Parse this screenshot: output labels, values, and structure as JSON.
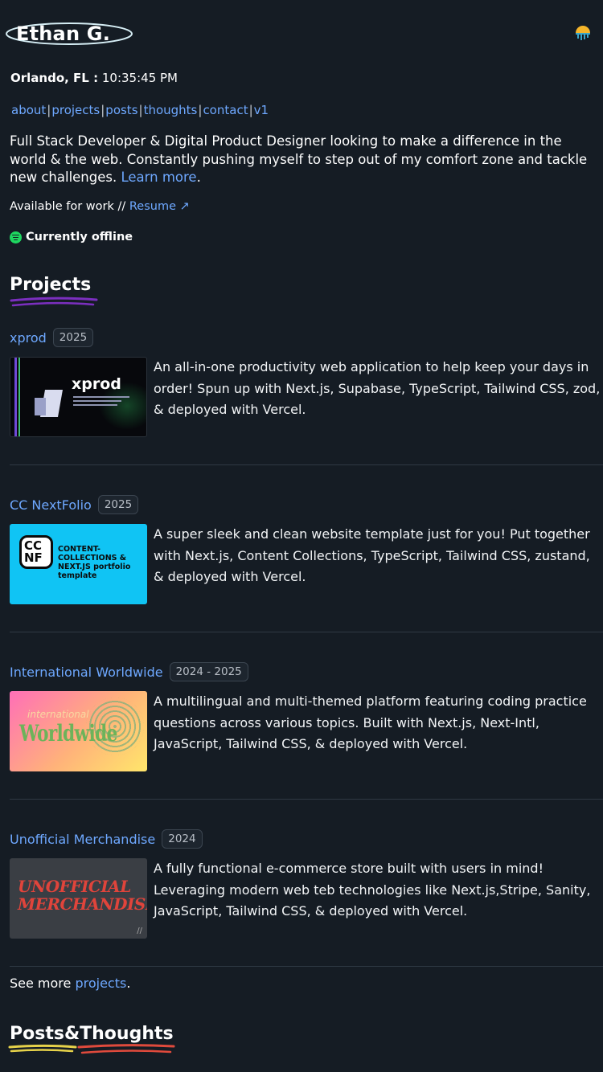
{
  "header": {
    "name": "Ethan G.",
    "location_city": "Orlando, FL :",
    "time": "10:35:45 PM"
  },
  "nav": {
    "items": [
      "about",
      "projects",
      "posts",
      "thoughts",
      "contact",
      "v1"
    ]
  },
  "bio": {
    "text": "Full Stack Developer & Digital Product Designer looking to make a difference in the world & the web. Constantly pushing myself to step out of my comfort zone and tackle new challenges. ",
    "link": "Learn more",
    "end": "."
  },
  "availability": {
    "text": "Available for work //",
    "resume": "Resume ↗"
  },
  "status": {
    "icon": "spotify-icon",
    "text": "Currently offline",
    "color": "#1ed760"
  },
  "projects_section": {
    "heading": "Projects",
    "accent": "#7b2fbf",
    "items": [
      {
        "title": "xprod",
        "year": "2025",
        "thumb_text": "xprod",
        "description": "An all-in-one productivity web application to help keep your days in order! Spun up with Next.js, Supabase, TypeScript, Tailwind CSS, zod, & deployed with Vercel."
      },
      {
        "title": "CC NextFolio",
        "year": "2025",
        "thumb_text": "CONTENT-COLLECTIONS & NEXT.JS portfolio template",
        "description": "A super sleek and clean website template just for you! Put together with Next.js, Content Collections, TypeScript, Tailwind CSS, zustand, & deployed with Vercel."
      },
      {
        "title": "International Worldwide",
        "year": "2024 - 2025",
        "thumb_text": "Worldwide",
        "description": "A multilingual and multi-themed platform featuring coding practice questions across various topics. Built with Next.js, Next-Intl, JavaScript, Tailwind CSS, & deployed with Vercel."
      },
      {
        "title": "Unofficial Merchandise",
        "year": "2024",
        "thumb_text": "UNOFFICIAL MERCHANDISE",
        "description": "A fully functional e-commerce store built with users in mind! Leveraging modern web teb technologies like Next.js,Stripe, Sanity, JavaScript, Tailwind CSS, & deployed with Vercel."
      }
    ]
  },
  "see_more": {
    "prefix": "See more ",
    "link": "projects",
    "suffix": "."
  },
  "posts_section": {
    "heading": "Posts&Thoughts"
  }
}
